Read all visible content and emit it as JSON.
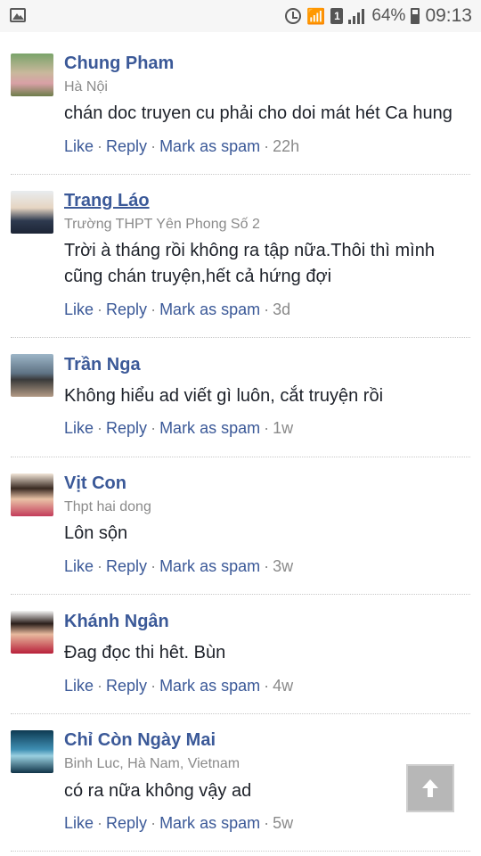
{
  "status_bar": {
    "battery": "64%",
    "sim": "1",
    "time": "09:13"
  },
  "comments": [
    {
      "name": "Chung Pham",
      "subtitle": "Hà Nội",
      "text": "chán doc truyen cu phải cho doi mát hét Ca hung",
      "like": "Like",
      "reply": "Reply",
      "spam": "Mark as spam",
      "time": "22h"
    },
    {
      "name": "Trang Láo",
      "subtitle": "Trường THPT Yên Phong Số 2",
      "text": "Trời à tháng rồi không ra tập nữa.Thôi thì mình cũng chán truyện,hết cả hứng đợi",
      "like": "Like",
      "reply": "Reply",
      "spam": "Mark as spam",
      "time": "3d"
    },
    {
      "name": "Trần Nga",
      "subtitle": "",
      "text": "Không hiểu ad viết gì luôn, cắt truyện rồi",
      "like": "Like",
      "reply": "Reply",
      "spam": "Mark as spam",
      "time": "1w"
    },
    {
      "name": "Vịt Con",
      "subtitle": "Thpt hai dong",
      "text": "Lôn sộn",
      "like": "Like",
      "reply": "Reply",
      "spam": "Mark as spam",
      "time": "3w"
    },
    {
      "name": "Khánh Ngân",
      "subtitle": "",
      "text": "Đag đọc thi hêt. Bùn",
      "like": "Like",
      "reply": "Reply",
      "spam": "Mark as spam",
      "time": "4w"
    },
    {
      "name": "Chỉ Còn Ngày Mai",
      "subtitle": "Binh Luc, Hà Nam, Vietnam",
      "text": "có ra nữa không vậy ad",
      "like": "Like",
      "reply": "Reply",
      "spam": "Mark as spam",
      "time": "5w"
    }
  ],
  "separator": "·",
  "colors": {
    "link": "#3b5998",
    "meta": "#8a8a8a",
    "text": "#1d2129"
  },
  "icons": [
    "image-icon",
    "alarm-icon",
    "wifi-icon",
    "sim-icon",
    "signal-icon",
    "battery-icon",
    "arrow-up-icon"
  ]
}
